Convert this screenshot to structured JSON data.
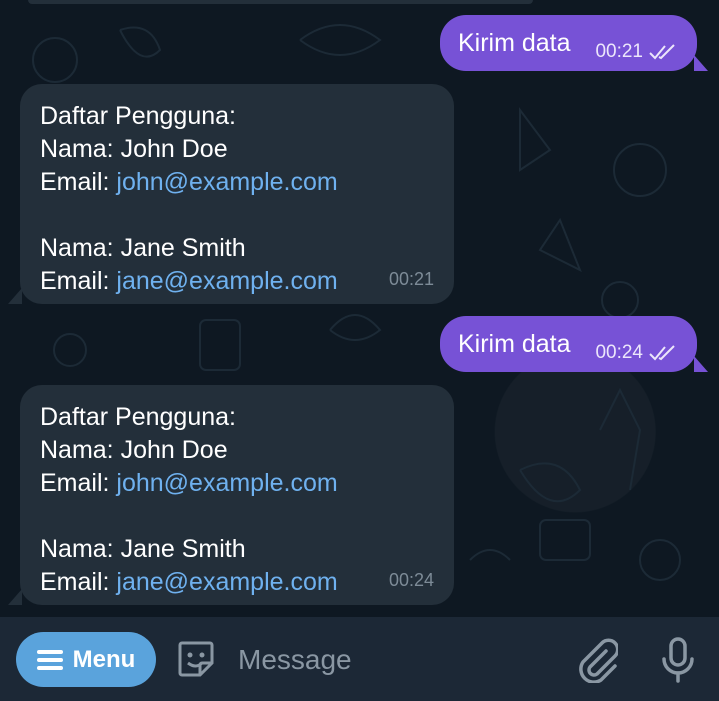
{
  "messages": [
    {
      "type": "outgoing",
      "text": "Kirim data",
      "time": "00:21"
    },
    {
      "type": "incoming",
      "title": "Daftar Pengguna:",
      "users": [
        {
          "name_line": "Nama: John Doe",
          "email_label": "Email: ",
          "email": "john@example.com"
        },
        {
          "name_line": "Nama: Jane Smith",
          "email_label": "Email: ",
          "email": "jane@example.com"
        }
      ],
      "time": "00:21"
    },
    {
      "type": "outgoing",
      "text": "Kirim data",
      "time": "00:24"
    },
    {
      "type": "incoming",
      "title": "Daftar Pengguna:",
      "users": [
        {
          "name_line": "Nama: John Doe",
          "email_label": "Email: ",
          "email": "john@example.com"
        },
        {
          "name_line": "Nama: Jane Smith",
          "email_label": "Email: ",
          "email": "jane@example.com"
        }
      ],
      "time": "00:24"
    }
  ],
  "bottom_bar": {
    "menu_label": "Menu",
    "input_placeholder": "Message",
    "icons": [
      "hamburger-icon",
      "sticker-icon",
      "paperclip-icon",
      "microphone-icon"
    ]
  },
  "colors": {
    "outgoing_bubble": "#7752d6",
    "incoming_bubble": "#232f3a",
    "link": "#6fb1ef",
    "menu_button": "#5aa3dc",
    "background": "#0e1822"
  }
}
